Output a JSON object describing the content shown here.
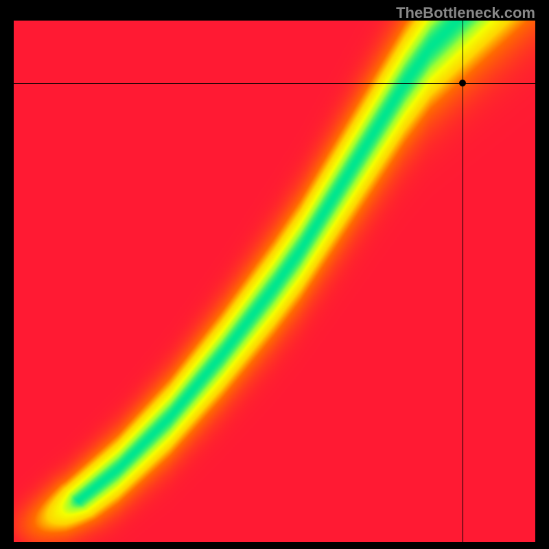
{
  "watermark": "TheBottleneck.com",
  "chart_data": {
    "type": "heatmap",
    "title": "",
    "xlabel": "",
    "ylabel": "",
    "xlim": [
      0,
      100
    ],
    "ylim": [
      0,
      100
    ],
    "grid": false,
    "legend": false,
    "colorscale": [
      {
        "t": 0.0,
        "hex": "#ff1a33"
      },
      {
        "t": 0.35,
        "hex": "#ff6a00"
      },
      {
        "t": 0.55,
        "hex": "#ffd400"
      },
      {
        "t": 0.75,
        "hex": "#f4ff00"
      },
      {
        "t": 0.88,
        "hex": "#9bff33"
      },
      {
        "t": 1.0,
        "hex": "#00e68f"
      }
    ],
    "ideal_curve": {
      "description": "center ridge of the green 'no bottleneck' band; x is CPU score, y is GPU score (percent of max). Curve is monotone increasing, sub-linear then super-linear.",
      "points": [
        {
          "x": 0,
          "y": 0
        },
        {
          "x": 10,
          "y": 6
        },
        {
          "x": 20,
          "y": 14
        },
        {
          "x": 30,
          "y": 24
        },
        {
          "x": 40,
          "y": 36
        },
        {
          "x": 50,
          "y": 49
        },
        {
          "x": 55,
          "y": 56
        },
        {
          "x": 60,
          "y": 64
        },
        {
          "x": 65,
          "y": 72
        },
        {
          "x": 70,
          "y": 80
        },
        {
          "x": 75,
          "y": 88
        },
        {
          "x": 80,
          "y": 95
        },
        {
          "x": 85,
          "y": 100
        }
      ],
      "band_halfwidth_pct": 6
    },
    "crosshair": {
      "x": 86,
      "y": 88
    },
    "marker": {
      "x": 86,
      "y": 88
    }
  }
}
